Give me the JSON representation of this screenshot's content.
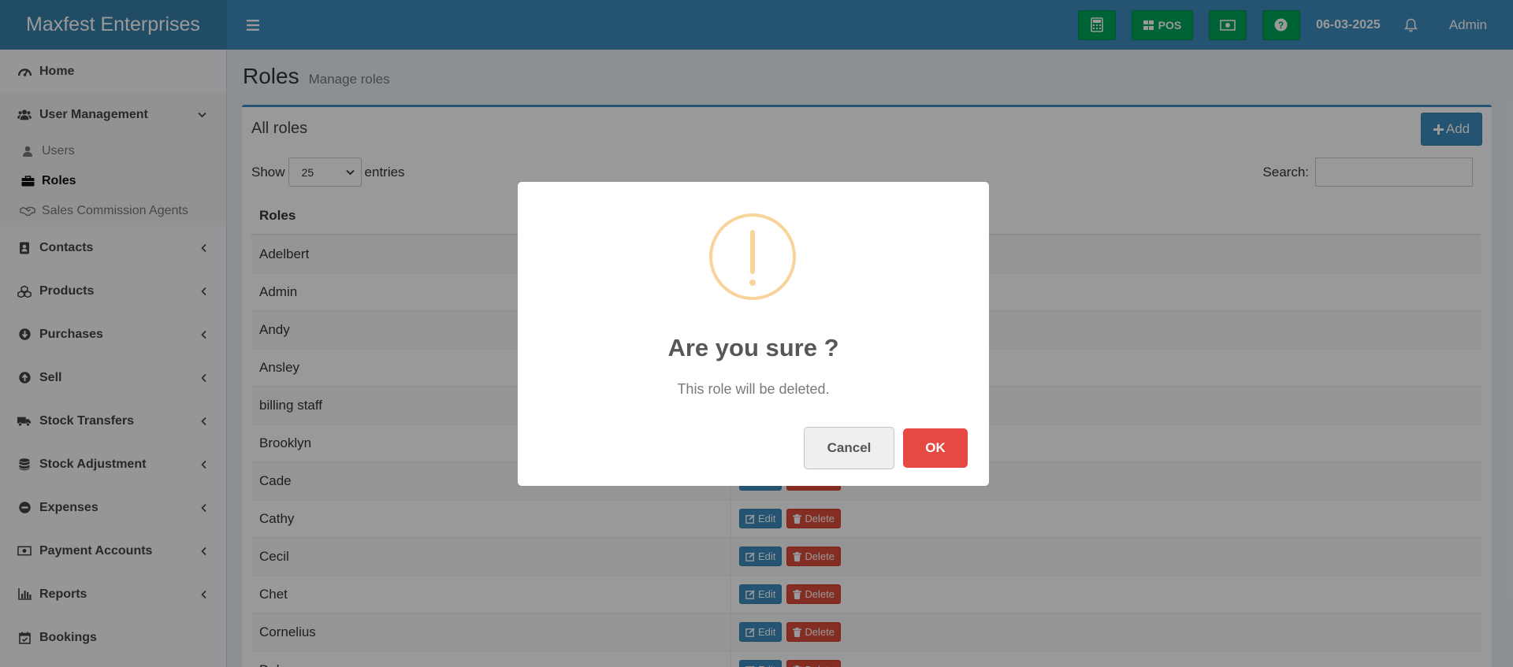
{
  "header": {
    "brand": "Maxfest Enterprises",
    "pos_label": "POS",
    "date": "06-03-2025",
    "user": "Admin"
  },
  "sidebar": {
    "items": [
      {
        "label": "Home",
        "icon": "dashboard-icon"
      },
      {
        "label": "User Management",
        "icon": "users-icon",
        "open": true
      },
      {
        "label": "Contacts",
        "icon": "address-book-icon"
      },
      {
        "label": "Products",
        "icon": "cubes-icon"
      },
      {
        "label": "Purchases",
        "icon": "arrow-circle-down-icon"
      },
      {
        "label": "Sell",
        "icon": "arrow-circle-up-icon"
      },
      {
        "label": "Stock Transfers",
        "icon": "truck-icon"
      },
      {
        "label": "Stock Adjustment",
        "icon": "database-icon"
      },
      {
        "label": "Expenses",
        "icon": "minus-circle-icon"
      },
      {
        "label": "Payment Accounts",
        "icon": "money-icon"
      },
      {
        "label": "Reports",
        "icon": "bar-chart-icon"
      },
      {
        "label": "Bookings",
        "icon": "calendar-check-icon"
      }
    ],
    "sub_items": [
      {
        "label": "Users",
        "icon": "user-icon"
      },
      {
        "label": "Roles",
        "icon": "briefcase-icon",
        "active": true
      },
      {
        "label": "Sales Commission Agents",
        "icon": "handshake-icon"
      }
    ]
  },
  "page": {
    "title": "Roles",
    "subtitle": "Manage roles",
    "box_title": "All roles",
    "add_label": "Add",
    "show_label": "Show",
    "entries_value": "25",
    "entries_label": "entries",
    "search_label": "Search:"
  },
  "table": {
    "header": "Roles",
    "edit_label": "Edit",
    "delete_label": "Delete",
    "rows": [
      "Adelbert",
      "Admin",
      "Andy",
      "Ansley",
      "billing staff",
      "Brooklyn",
      "Cade",
      "Cathy",
      "Cecil",
      "Chet",
      "Cornelius",
      "Dale"
    ]
  },
  "modal": {
    "title": "Are you sure ?",
    "text": "This role will be deleted.",
    "cancel_label": "Cancel",
    "ok_label": "OK"
  },
  "colors": {
    "header": "#3c8dbc",
    "brand_bg": "#367fa9",
    "green": "#00a65a",
    "danger": "#dd4b39",
    "warning": "#f8d49a",
    "ok": "#e64942"
  }
}
